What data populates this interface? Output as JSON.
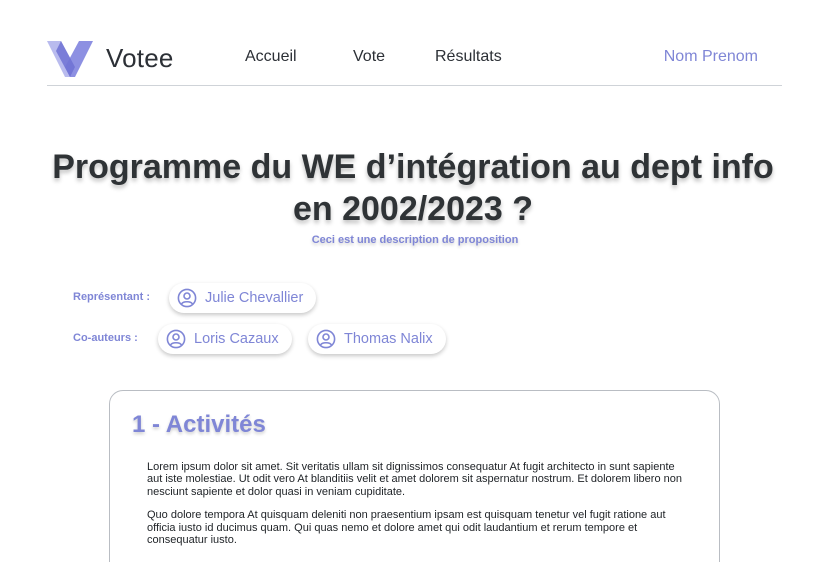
{
  "header": {
    "brand": "Votee",
    "nav": [
      "Accueil",
      "Vote",
      "Résultats"
    ],
    "user": "Nom Prenom"
  },
  "proposal": {
    "title": "Programme du WE d’intégration au dept info en 2002/2023 ?",
    "description": "Ceci est une description de proposition"
  },
  "people": {
    "representative_label": "Représentant :",
    "representative": "Julie Chevallier",
    "coauthors_label": "Co-auteurs :",
    "coauthors": [
      "Loris Cazaux",
      "Thomas Nalix"
    ]
  },
  "section": {
    "title": "1 - Activités",
    "paragraphs": [
      "Lorem ipsum dolor sit amet. Sit veritatis ullam sit dignissimos consequatur At fugit architecto in sunt sapiente aut iste molestiae. Ut odit vero At blanditiis velit et amet dolorem sit aspernatur nostrum. Et dolorem libero non nesciunt sapiente et dolor quasi in veniam cupiditate.",
      "Quo dolore tempora At quisquam deleniti non praesentium ipsam est quisquam tenetur vel fugit ratione aut officia iusto id ducimus quam. Qui quas nemo et dolore amet qui odit laudantium et rerum tempore et consequatur iusto."
    ]
  },
  "colors": {
    "accent": "#7f86d6",
    "text": "#2c3036",
    "border": "#cfd3d8"
  },
  "icons": {
    "logo": "votee-logo",
    "person": "user-circle-icon"
  }
}
